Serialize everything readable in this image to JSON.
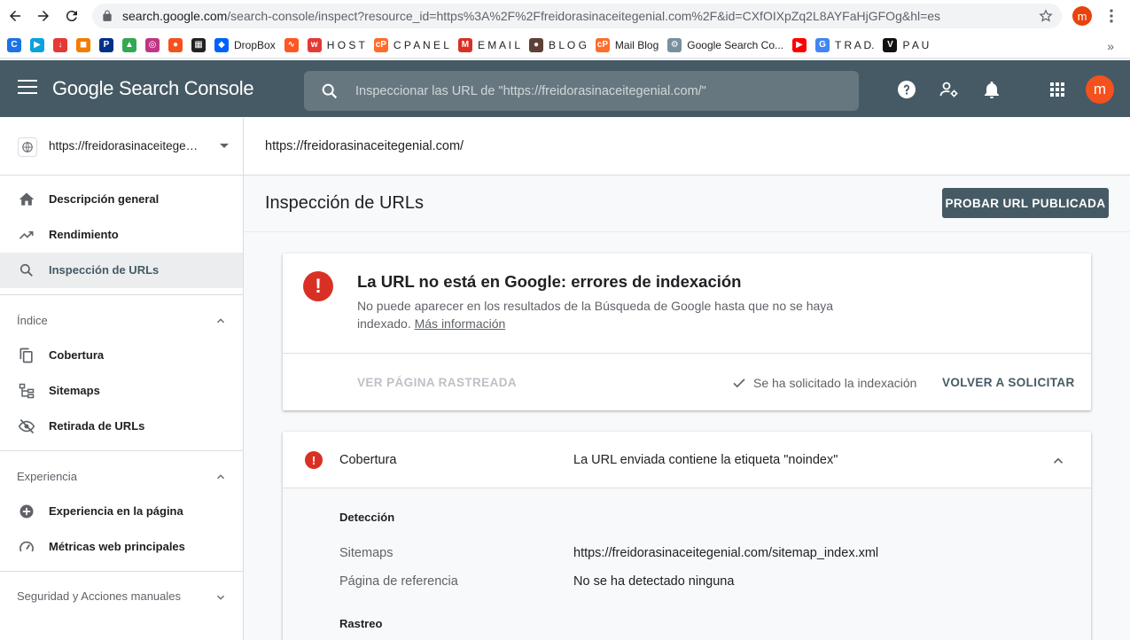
{
  "browser": {
    "url_host": "search.google.com",
    "url_rest": "/search-console/inspect?resource_id=https%3A%2F%2Ffreidorasinaceitegenial.com%2F&id=CXfOIXpZq2L8AYFaHjGFOg&hl=es",
    "profile_initial": "m",
    "bookmarks": [
      {
        "label": "",
        "icon": "c-logo-icon",
        "color": "#1a73e8"
      },
      {
        "label": "",
        "icon": "play-icon",
        "color": "#0aa1dd"
      },
      {
        "label": "",
        "icon": "save-icon",
        "color": "#e53935"
      },
      {
        "label": "",
        "icon": "orange-square-icon",
        "color": "#f57c00"
      },
      {
        "label": "",
        "icon": "paypal-icon",
        "color": "#003087"
      },
      {
        "label": "",
        "icon": "drive-icon",
        "color": "#34a853"
      },
      {
        "label": "",
        "icon": "instagram-icon",
        "color": "#c13584"
      },
      {
        "label": "",
        "icon": "orange-circle-icon",
        "color": "#f4511e"
      },
      {
        "label": "",
        "icon": "grid-logo-icon",
        "color": "#212121"
      },
      {
        "label": "DropBox",
        "icon": "dropbox-icon",
        "color": "#0061ff"
      },
      {
        "label": "",
        "icon": "analytics-icon",
        "color": "#ff5722"
      },
      {
        "label": "H O S T",
        "icon": "host-icon",
        "color": "#e53935"
      },
      {
        "label": "C P A N E L",
        "icon": "cpanel-icon",
        "color": "#ff6c2c"
      },
      {
        "label": "E M A I L",
        "icon": "gmail-icon",
        "color": "#d93025"
      },
      {
        "label": "B L O G",
        "icon": "blog-icon",
        "color": "#5d4037"
      },
      {
        "label": "Mail Blog",
        "icon": "cpanel-icon",
        "color": "#ff6c2c"
      },
      {
        "label": "Google Search Co...",
        "icon": "search-console-icon",
        "color": "#78909c"
      },
      {
        "label": "",
        "icon": "youtube-icon",
        "color": "#ff0000"
      },
      {
        "label": "T R A D.",
        "icon": "translate-icon",
        "color": "#4285f4"
      },
      {
        "label": "P A U",
        "icon": "vo-icon",
        "color": "#111111"
      }
    ],
    "more": "»"
  },
  "appbar": {
    "brand_google": "Google",
    "brand_product": "Search Console",
    "search_placeholder": "Inspeccionar las URL de \"https://freidorasinaceitegenial.com/\"",
    "avatar_initial": "m"
  },
  "sidebar": {
    "property": "https://freidorasinaceitegenial.com/",
    "top_items": [
      {
        "label": "Descripción general",
        "icon": "home-icon"
      },
      {
        "label": "Rendimiento",
        "icon": "trending-up-icon"
      },
      {
        "label": "Inspección de URLs",
        "icon": "search-icon",
        "active": true
      }
    ],
    "sections": [
      {
        "title": "Índice",
        "expanded": true,
        "items": [
          {
            "label": "Cobertura",
            "icon": "copy-icon"
          },
          {
            "label": "Sitemaps",
            "icon": "sitemap-icon"
          },
          {
            "label": "Retirada de URLs",
            "icon": "eye-off-icon"
          }
        ]
      },
      {
        "title": "Experiencia",
        "expanded": true,
        "items": [
          {
            "label": "Experiencia en la página",
            "icon": "add-circle-icon"
          },
          {
            "label": "Métricas web principales",
            "icon": "speed-icon"
          }
        ]
      },
      {
        "title": "Seguridad y Acciones manuales",
        "expanded": false
      }
    ]
  },
  "main": {
    "inspected_url": "https://freidorasinaceitegenial.com/",
    "page_title": "Inspección de URLs",
    "test_button": "PROBAR URL PUBLICADA",
    "status_card": {
      "title": "La URL no está en Google: errores de indexación",
      "desc_1": "No puede aparecer en los resultados de la Búsqueda de Google hasta que no se haya",
      "desc_2": "indexado.",
      "more_link": "Más información",
      "view_crawled": "VER PÁGINA RASTREADA",
      "requested": "Se ha solicitado la indexación",
      "rerequest": "VOLVER A SOLICITAR"
    },
    "coverage": {
      "label": "Cobertura",
      "value": "La URL enviada contiene la etiqueta \"noindex\"",
      "detection_heading": "Detección",
      "rows": [
        {
          "key": "Sitemaps",
          "value": "https://freidorasinaceitegenial.com/sitemap_index.xml"
        },
        {
          "key": "Página de referencia",
          "value": "No se ha detectado ninguna"
        }
      ],
      "crawl_heading": "Rastreo"
    }
  },
  "colors": {
    "appbar": "#455a64",
    "error": "#d93025",
    "avatar": "#f4511e"
  }
}
